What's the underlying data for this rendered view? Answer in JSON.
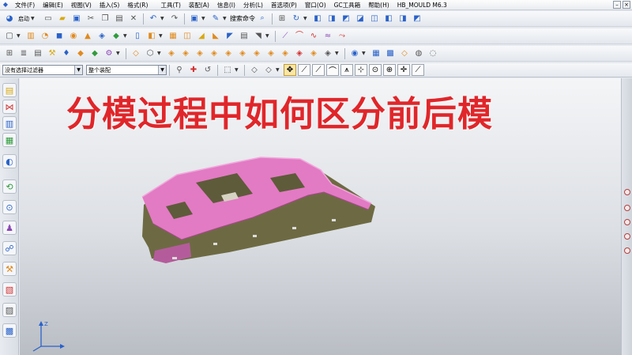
{
  "menu": {
    "items": [
      "文件(F)",
      "编辑(E)",
      "视图(V)",
      "插入(S)",
      "格式(R)",
      "工具(T)",
      "装配(A)",
      "信息(I)",
      "分析(L)",
      "首选项(P)",
      "窗口(O)",
      "GC工具箱",
      "帮助(H)",
      "HB_MOULD M6.3"
    ],
    "search_placeholder": "搜索命令"
  },
  "toolbar": {
    "start_label": "启动"
  },
  "filterbar": {
    "selection_filter": "没有选择过滤器",
    "assembly_scope": "整个装配"
  },
  "headline": "分模过程中如何区分前后模",
  "colors": {
    "headline": "#e0262a",
    "part_top": "#e37ac4",
    "part_side": "#6d6a43",
    "active_snap": "#f9e6a8"
  }
}
